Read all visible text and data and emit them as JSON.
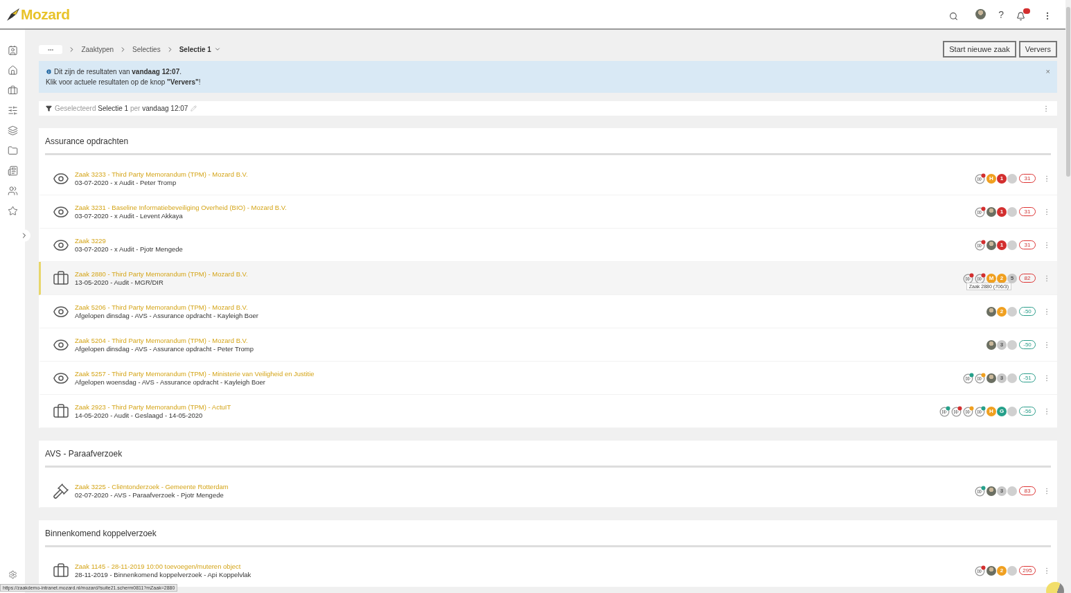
{
  "logo": "Mozard",
  "header": {
    "help": "?"
  },
  "breadcrumb": {
    "ellipsis": "•••",
    "items": [
      "Zaaktypen",
      "Selecties",
      "Selectie 1"
    ]
  },
  "actions": [
    "Start nieuwe zaak",
    "Ververs"
  ],
  "info": {
    "lines": [
      "Dit zijn de resultaten van **vandaag 12:07**.",
      "Klik voor actuele resultaten op de knop **\"Ververs\"**!"
    ],
    "close": "×"
  },
  "filter": {
    "label": "Geselecteerd",
    "selection": "Selectie 1",
    "per": "per",
    "time": "vandaag 12:07"
  },
  "sections": [
    {
      "title": "Assurance opdrachten",
      "rows": [
        {
          "kind": "eye",
          "selected": false,
          "title": "Zaak 3233 - Third Party Memorandum (TPM) - Mozard B.V.",
          "subtitle": "03-07-2020 - x Audit - Peter Tromp",
          "badges": [
            {
              "kind": "action",
              "color": "#d32f2f"
            },
            {
              "kind": "letter",
              "text": "H",
              "color": "#f0a020"
            },
            {
              "kind": "letter",
              "text": "1",
              "color": "#d32f2f"
            },
            {
              "kind": "blank"
            }
          ],
          "days": "31",
          "overdue": true
        },
        {
          "kind": "eye",
          "selected": false,
          "title": "Zaak 3231 - Baseline Informatiebeveiliging Overheid (BIO) - Mozard B.V.",
          "subtitle": "03-07-2020 - x Audit - Levent Akkaya",
          "badges": [
            {
              "kind": "action",
              "color": "#d32f2f"
            },
            {
              "kind": "avatar"
            },
            {
              "kind": "letter",
              "text": "1",
              "color": "#d32f2f"
            },
            {
              "kind": "blank"
            }
          ],
          "days": "31",
          "overdue": true
        },
        {
          "kind": "eye",
          "selected": false,
          "title": "Zaak 3229",
          "subtitle": "03-07-2020 - x Audit - Pjotr Mengede",
          "badges": [
            {
              "kind": "action",
              "color": "#d32f2f"
            },
            {
              "kind": "avatar"
            },
            {
              "kind": "letter",
              "text": "1",
              "color": "#d32f2f"
            },
            {
              "kind": "blank"
            }
          ],
          "days": "31",
          "overdue": true
        },
        {
          "kind": "briefcase",
          "selected": true,
          "title": "Zaak 2880 - Third Party Memorandum (TPM) - Mozard B.V.",
          "subtitle": "13-05-2020 - Audit - MGR/DIR",
          "tooltip": "Zaak 2880 (706/3)",
          "badges": [
            {
              "kind": "action",
              "color": "#d32f2f"
            },
            {
              "kind": "action",
              "color": "#d32f2f"
            },
            {
              "kind": "letter",
              "text": "M",
              "color": "#f0a020"
            },
            {
              "kind": "letter",
              "text": "2",
              "color": "#f0a020"
            },
            {
              "kind": "letter",
              "text": "5",
              "color": "#c8c8c8"
            }
          ],
          "days": "82",
          "overdue": true
        },
        {
          "kind": "eye",
          "selected": false,
          "title": "Zaak 5206 - Third Party Memorandum (TPM) - Mozard B.V.",
          "subtitle": "Afgelopen dinsdag - AVS - Assurance opdracht - Kayleigh Boer",
          "badges": [
            {
              "kind": "avatar"
            },
            {
              "kind": "letter",
              "text": "2",
              "color": "#f0a020"
            },
            {
              "kind": "blank"
            }
          ],
          "days": "-50",
          "overdue": false
        },
        {
          "kind": "eye",
          "selected": false,
          "title": "Zaak 5204 - Third Party Memorandum (TPM) - Mozard B.V.",
          "subtitle": "Afgelopen dinsdag - AVS - Assurance opdracht - Peter Tromp",
          "badges": [
            {
              "kind": "avatar"
            },
            {
              "kind": "letter",
              "text": "3",
              "color": "#c8c8c8"
            },
            {
              "kind": "blank"
            }
          ],
          "days": "-50",
          "overdue": false
        },
        {
          "kind": "eye",
          "selected": false,
          "title": "Zaak 5257 - Third Party Memorandum (TPM) - Ministerie van Veiligheid en Justitie",
          "subtitle": "Afgelopen woensdag - AVS - Assurance opdracht - Kayleigh Boer",
          "badges": [
            {
              "kind": "action",
              "color": "#26a08a"
            },
            {
              "kind": "action",
              "color": "#f0a020"
            },
            {
              "kind": "avatar"
            },
            {
              "kind": "letter",
              "text": "3",
              "color": "#c8c8c8"
            },
            {
              "kind": "blank"
            }
          ],
          "days": "-51",
          "overdue": false
        },
        {
          "kind": "briefcase",
          "selected": false,
          "title": "Zaak 2923 - Third Party Memorandum (TPM) - ActuIT",
          "subtitle": "14-05-2020 - Audit - Geslaagd - 14-05-2020",
          "badges": [
            {
              "kind": "action",
              "color": "#26a08a"
            },
            {
              "kind": "action",
              "color": "#d32f2f"
            },
            {
              "kind": "action",
              "color": "#f0a020"
            },
            {
              "kind": "action",
              "color": "#26a08a"
            },
            {
              "kind": "letter",
              "text": "H",
              "color": "#f0a020"
            },
            {
              "kind": "letter",
              "text": "G",
              "color": "#26a08a"
            },
            {
              "kind": "blank"
            }
          ],
          "days": "-56",
          "overdue": false
        }
      ]
    },
    {
      "title": "AVS - Paraafverzoek",
      "rows": [
        {
          "kind": "hammer",
          "selected": false,
          "title": "Zaak 3225 - Cliëntonderzoek - Gemeente Rotterdam",
          "subtitle": "02-07-2020 - AVS - Paraafverzoek - Pjotr Mengede",
          "badges": [
            {
              "kind": "action",
              "color": "#26a08a"
            },
            {
              "kind": "avatar"
            },
            {
              "kind": "letter",
              "text": "3",
              "color": "#c8c8c8"
            },
            {
              "kind": "blank"
            }
          ],
          "days": "83",
          "overdue": true
        }
      ]
    },
    {
      "title": "Binnenkomend koppelverzoek",
      "rows": [
        {
          "kind": "briefcase",
          "selected": false,
          "title": "Zaak 1145 - 28-11-2019 10:00 toevoegen/muteren object",
          "subtitle": "28-11-2019 - Binnenkomend koppelverzoek - Api Koppelvlak",
          "badges": [
            {
              "kind": "action",
              "color": "#d32f2f"
            },
            {
              "kind": "avatar"
            },
            {
              "kind": "letter",
              "text": "2",
              "color": "#f0a020"
            },
            {
              "kind": "blank"
            }
          ],
          "days": "295",
          "overdue": true
        }
      ]
    }
  ],
  "status_url": "https://zaakdemo-intranet.mozard.nl/mozard/!suite21.scherm0811?mZaak=2880"
}
